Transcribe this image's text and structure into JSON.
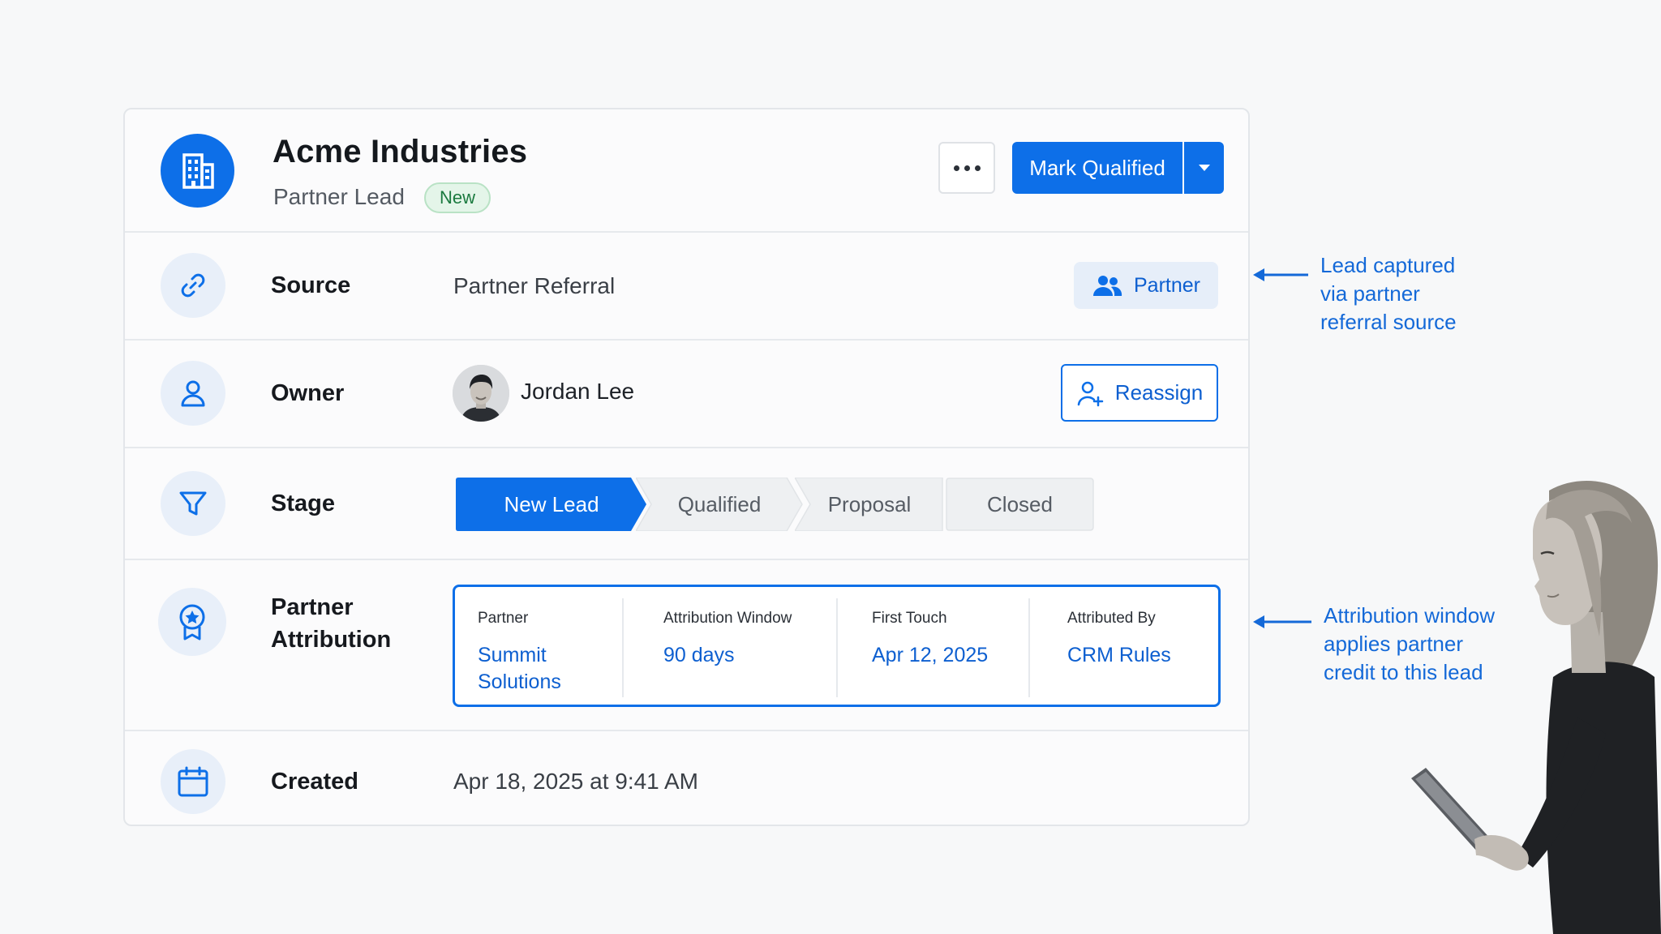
{
  "header": {
    "company_name": "Acme Industries",
    "lead_type": "Partner Lead",
    "status_badge": "New",
    "primary_action": "Mark Qualified",
    "more_menu_icon": "ellipsis-icon",
    "logo_icon": "building-icon"
  },
  "rows": {
    "source": {
      "label": "Source",
      "value": "Partner Referral",
      "tag": "Partner",
      "icon": "link-icon"
    },
    "owner": {
      "label": "Owner",
      "name": "Jordan Lee",
      "action": "Reassign",
      "icon": "user-icon"
    },
    "stage": {
      "label": "Stage",
      "icon": "funnel-icon",
      "steps": [
        "New Lead",
        "Qualified",
        "Proposal",
        "Closed"
      ],
      "active_index": 0
    },
    "attribution": {
      "label_line1": "Partner",
      "label_line2": "Attribution",
      "icon": "badge-star-icon",
      "columns": [
        {
          "key": "Partner",
          "value_line1": "Summit",
          "value_line2": "Solutions"
        },
        {
          "key": "Attribution Window",
          "value_line1": "90 days",
          "value_line2": ""
        },
        {
          "key": "First Touch",
          "value_line1": "Apr 12, 2025",
          "value_line2": ""
        },
        {
          "key": "Attributed By",
          "value_line1": "CRM Rules",
          "value_line2": ""
        }
      ]
    },
    "created": {
      "label": "Created",
      "value": "Apr 18, 2025 at 9:41 AM",
      "icon": "calendar-icon"
    }
  },
  "annotations": {
    "source_note": [
      "Lead captured",
      "via partner",
      "referral source"
    ],
    "attribution_note": [
      "Attribution window",
      "applies partner",
      "credit to this lead"
    ]
  },
  "colors": {
    "accent": "#0d6fe8",
    "accent_text": "#0d5fd0",
    "badge_bg": "#e4f5e9",
    "badge_text": "#1b7a3f",
    "annotation": "#1469d8"
  }
}
